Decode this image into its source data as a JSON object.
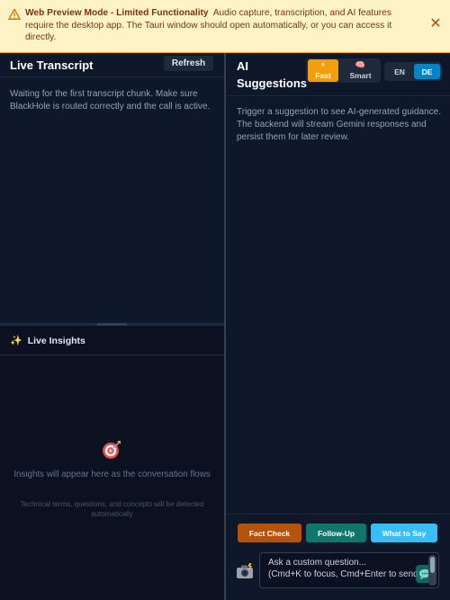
{
  "banner": {
    "title": "Web Preview Mode - Limited Functionality",
    "message": "Audio capture, transcription, and AI features require the desktop app. The Tauri window should open automatically, or you can access it directly.",
    "close_symbol": "✕",
    "colors": {
      "background": "#fef3c7",
      "text": "#78350f",
      "accent": "#b45309"
    },
    "icons": {
      "warning": "warning-triangle-icon",
      "close": "close-icon"
    }
  },
  "transcript": {
    "title": "Live Transcript",
    "refresh_label": "Refresh",
    "empty_message": "Waiting for the first transcript chunk. Make sure BlackHole is routed correctly and the call is active."
  },
  "insights": {
    "icon_glyph": "✨",
    "title": "Live Insights",
    "empty_icon": "target-icon",
    "empty_message": "Insights will appear here as the conversation flows",
    "empty_sub": "Technical terms, questions, and concepts will be detected automatically"
  },
  "suggestions": {
    "title": "AI Suggestions",
    "modes": [
      {
        "icon": "⚡",
        "label": "Fast",
        "active": true,
        "color": "#f59e0b"
      },
      {
        "icon": "🧠",
        "label": "Smart",
        "active": false
      }
    ],
    "languages": [
      {
        "label": "EN",
        "active": false
      },
      {
        "label": "DE",
        "active": true,
        "color": "#0284c7"
      }
    ],
    "empty_message": "Trigger a suggestion to see AI-generated guidance. The backend will stream Gemini responses and persist them for later review.",
    "actions": [
      {
        "label": "Fact Check",
        "color": "#b45309"
      },
      {
        "label": "Follow-Up",
        "color": "#0f766e"
      },
      {
        "label": "What to Say",
        "color": "#38bdf8"
      }
    ],
    "question_placeholder": "Ask a custom question...\n(Cmd+K to focus, Cmd+Enter to send)",
    "camera_icon": "camera-flash-icon",
    "send_icon": "chat-send-icon"
  }
}
